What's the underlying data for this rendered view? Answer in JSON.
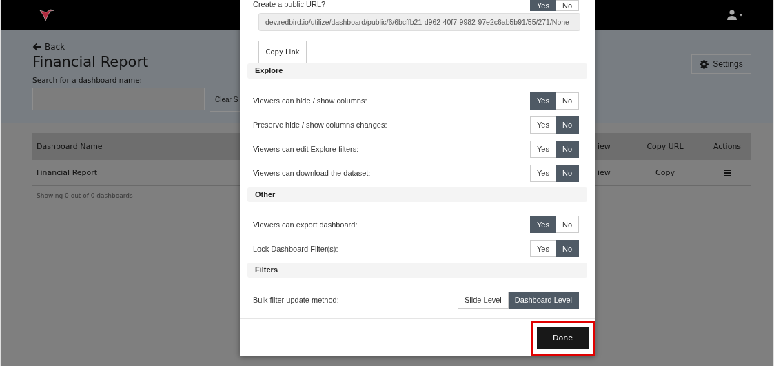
{
  "back_link": "Back",
  "page_title": "Financial Report",
  "search": {
    "label": "Search for a dashboard name:",
    "clear_button": "Clear S"
  },
  "settings_button": "Settings",
  "table": {
    "columns": [
      "Dashboard Name",
      "iew",
      "Copy URL",
      "Actions"
    ],
    "rows": [
      {
        "cells": [
          "Financial Report",
          "iew",
          "Copy"
        ]
      }
    ],
    "footer": "Showing 0 out of 0 dashboards"
  },
  "modal": {
    "public_url": {
      "label": "Create a public URL?",
      "options": [
        {
          "label": "Yes",
          "selected": true
        },
        {
          "label": "No",
          "selected": false
        }
      ],
      "url": "dev.redbird.io/utilize/dashboard/public/6/6bcffb21-d962-40f7-9982-97e2c6ab5b91/55/271/None",
      "copy_button": "Copy Link"
    },
    "sections": [
      {
        "title": "Explore",
        "settings": [
          {
            "label": "Viewers can hide / show columns:",
            "options": [
              {
                "label": "Yes",
                "selected": true
              },
              {
                "label": "No",
                "selected": false
              }
            ]
          },
          {
            "label": "Preserve hide / show columns changes:",
            "options": [
              {
                "label": "Yes",
                "selected": false
              },
              {
                "label": "No",
                "selected": true
              }
            ]
          },
          {
            "label": "Viewers can edit Explore filters:",
            "options": [
              {
                "label": "Yes",
                "selected": false
              },
              {
                "label": "No",
                "selected": true
              }
            ]
          },
          {
            "label": "Viewers can download the dataset:",
            "options": [
              {
                "label": "Yes",
                "selected": false
              },
              {
                "label": "No",
                "selected": true
              }
            ]
          }
        ]
      },
      {
        "title": "Other",
        "settings": [
          {
            "label": "Viewers can export dashboard:",
            "options": [
              {
                "label": "Yes",
                "selected": true
              },
              {
                "label": "No",
                "selected": false
              }
            ]
          },
          {
            "label": "Lock Dashboard Filter(s):",
            "options": [
              {
                "label": "Yes",
                "selected": false
              },
              {
                "label": "No",
                "selected": true
              }
            ]
          }
        ]
      },
      {
        "title": "Filters",
        "settings": [
          {
            "label": "Bulk filter update method:",
            "options": [
              {
                "label": "Slide Level",
                "selected": false
              },
              {
                "label": "Dashboard Level",
                "selected": true
              }
            ]
          }
        ]
      }
    ],
    "done_button": "Done",
    "done_highlighted": true
  }
}
